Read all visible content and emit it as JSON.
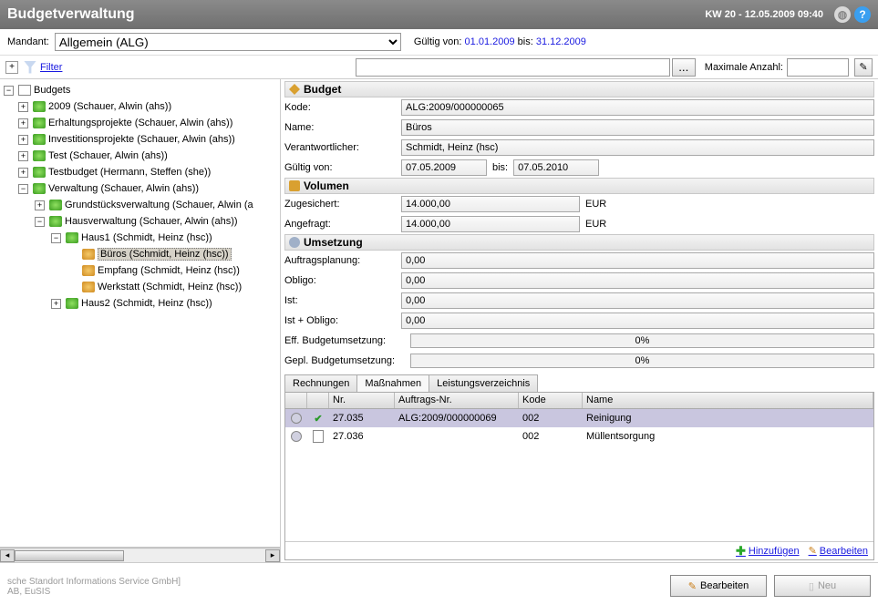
{
  "header": {
    "title": "Budgetverwaltung",
    "date": "KW 20 - 12.05.2009 09:40"
  },
  "mandant": {
    "label": "Mandant:",
    "value": "Allgemein (ALG)"
  },
  "valid": {
    "prefix": "Gültig von:",
    "from": "01.01.2009",
    "mid": "bis:",
    "to": "31.12.2009"
  },
  "filter": {
    "link": "Filter",
    "maxlabel": "Maximale Anzahl:"
  },
  "tree": {
    "root": "Budgets",
    "n1": "2009 (Schauer, Alwin (ahs))",
    "n2": "Erhaltungsprojekte (Schauer, Alwin (ahs))",
    "n3": "Investitionsprojekte (Schauer, Alwin (ahs))",
    "n4": "Test (Schauer, Alwin (ahs))",
    "n5": "Testbudget (Hermann, Steffen  (she))",
    "n6": "Verwaltung (Schauer, Alwin (ahs))",
    "n61": "Grundstücksverwaltung (Schauer, Alwin (a",
    "n62": "Hausverwaltung (Schauer, Alwin (ahs))",
    "n621": "Haus1 (Schmidt, Heinz (hsc))",
    "n6211": "Büros (Schmidt, Heinz (hsc))",
    "n6212": "Empfang (Schmidt, Heinz (hsc))",
    "n6213": "Werkstatt (Schmidt, Heinz (hsc))",
    "n622": "Haus2 (Schmidt, Heinz (hsc))"
  },
  "sec": {
    "budget": "Budget",
    "volumen": "Volumen",
    "umsetzung": "Umsetzung"
  },
  "budget": {
    "kode_l": "Kode:",
    "kode": "ALG:2009/000000065",
    "name_l": "Name:",
    "name": "Büros",
    "verant_l": "Verantwortlicher:",
    "verant": "Schmidt, Heinz (hsc)",
    "gv_l": "Gültig von:",
    "gv": "07.05.2009",
    "gb_l": "bis:",
    "gb": "07.05.2010"
  },
  "vol": {
    "zu_l": "Zugesichert:",
    "zu": "14.000,00",
    "zu_u": "EUR",
    "an_l": "Angefragt:",
    "an": "14.000,00",
    "an_u": "EUR"
  },
  "ums": {
    "ap_l": "Auftragsplanung:",
    "ap": "0,00",
    "ob_l": "Obligo:",
    "ob": "0,00",
    "ist_l": "Ist:",
    "ist": "0,00",
    "io_l": "Ist + Obligo:",
    "io": "0,00",
    "eff_l": "Eff. Budgetumsetzung:",
    "eff": "0%",
    "gep_l": "Gepl. Budgetumsetzung:",
    "gep": "0%"
  },
  "tabs": {
    "t1": "Rechnungen",
    "t2": "Maßnahmen",
    "t3": "Leistungsverzeichnis"
  },
  "gridh": {
    "nr": "Nr.",
    "anr": "Auftrags-Nr.",
    "kode": "Kode",
    "name": "Name"
  },
  "rows": [
    {
      "nr": "27.035",
      "anr": "ALG:2009/000000069",
      "kode": "002",
      "name": "Reinigung",
      "chk": true
    },
    {
      "nr": "27.036",
      "anr": "",
      "kode": "002",
      "name": "Müllentsorgung",
      "chk": false
    }
  ],
  "actions": {
    "add": "Hinzufügen",
    "edit": "Bearbeiten"
  },
  "footer": {
    "l1": "sche Standort Informations Service GmbH]",
    "l2": "AB, EuSIS",
    "edit": "Bearbeiten",
    "new": "Neu"
  }
}
